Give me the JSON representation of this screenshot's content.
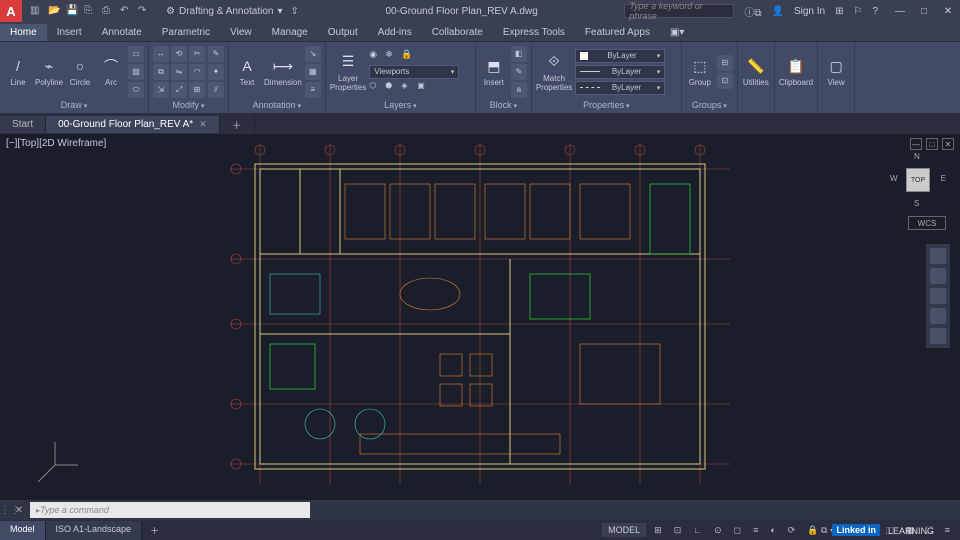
{
  "title_doc": "00-Ground Floor Plan_REV A.dwg",
  "workspace": "Drafting & Annotation",
  "search_placeholder": "Type a keyword or phrase",
  "signin": "Sign In",
  "menu": [
    "Home",
    "Insert",
    "Annotate",
    "Parametric",
    "View",
    "Manage",
    "Output",
    "Add-ins",
    "Collaborate",
    "Express Tools",
    "Featured Apps"
  ],
  "menu_active": 0,
  "ribbon": {
    "draw": {
      "title": "Draw",
      "items": [
        "Line",
        "Polyline",
        "Circle",
        "Arc"
      ]
    },
    "modify": {
      "title": "Modify"
    },
    "annotation": {
      "title": "Annotation",
      "text": "Text",
      "dim": "Dimension"
    },
    "layers": {
      "title": "Layers",
      "btn": "Layer\nProperties",
      "combo": "Viewports"
    },
    "block": {
      "title": "Block",
      "btn": "Insert"
    },
    "properties": {
      "title": "Properties",
      "btn": "Match\nProperties",
      "combo": "ByLayer"
    },
    "groups": {
      "title": "Groups",
      "btn": "Group"
    },
    "utilities": {
      "title": "Utilities"
    },
    "clipboard": {
      "title": "Clipboard"
    },
    "view": {
      "title": "View"
    }
  },
  "doctabs": {
    "start": "Start",
    "file": "00-Ground Floor Plan_REV A*"
  },
  "viewport_label": "[−][Top][2D Wireframe]",
  "viewcube": {
    "top": "TOP",
    "n": "N",
    "s": "S",
    "e": "E",
    "w": "W"
  },
  "wcs": "WCS",
  "command_placeholder": "Type a command",
  "model_tab": "Model",
  "layout_tab": "ISO A1-Landscape",
  "status_model": "MODEL",
  "linkedin": "Linked in",
  "learning": "LEARNING"
}
